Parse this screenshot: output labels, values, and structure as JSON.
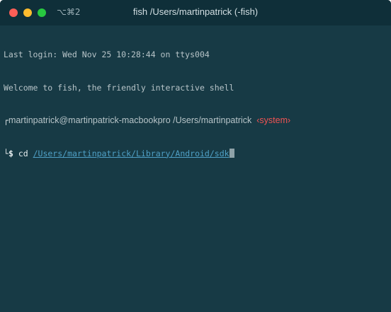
{
  "window": {
    "shortcut": "⌥⌘2",
    "title": "fish /Users/martinpatrick (-fish)"
  },
  "terminal": {
    "last_login": "Last login: Wed Nov 25 10:28:44 on ttys004",
    "welcome": "Welcome to fish, the friendly interactive shell",
    "prompt": {
      "user_host": "martinpatrick@martinpatrick-macbookpro",
      "cwd": "/Users/martinpatrick",
      "tag": "‹system›"
    },
    "command": {
      "symbol": "$",
      "name": "cd",
      "argument": "/Users/martinpatrick/Library/Android/sdk"
    }
  },
  "colors": {
    "background": "#173a45",
    "titlebar": "#0f2f39",
    "tag": "#f05353",
    "path_link": "#4fa0c6"
  }
}
